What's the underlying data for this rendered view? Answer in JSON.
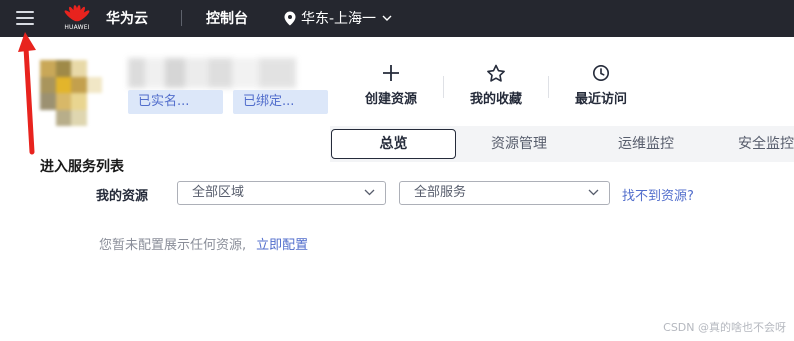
{
  "topbar": {
    "logo_text": "HUAWEI",
    "brand": "华为云",
    "console": "控制台",
    "region": "华东-上海一"
  },
  "user": {
    "badge_realname": "已实名...",
    "badge_bound": "已绑定..."
  },
  "quick_links": [
    {
      "label": "创建资源",
      "icon": "plus-icon"
    },
    {
      "label": "我的收藏",
      "icon": "star-icon"
    },
    {
      "label": "最近访问",
      "icon": "clock-icon"
    }
  ],
  "tabs": [
    {
      "label": "总览",
      "active": true
    },
    {
      "label": "资源管理",
      "active": false
    },
    {
      "label": "运维监控",
      "active": false
    },
    {
      "label": "安全监控",
      "active": false
    }
  ],
  "annotation": {
    "text": "进入服务列表"
  },
  "resources": {
    "label": "我的资源",
    "region_select": "全部区域",
    "service_select": "全部服务",
    "help_link": "找不到资源?",
    "empty_text": "您暂未配置展示任何资源,",
    "configure_link": "立即配置"
  },
  "watermark": "CSDN @真的啥也不会呀",
  "colors": {
    "topbar_bg": "#25272f",
    "accent": "#526ecc",
    "badge_bg": "#dce7f9",
    "arrow": "#e8231e"
  }
}
